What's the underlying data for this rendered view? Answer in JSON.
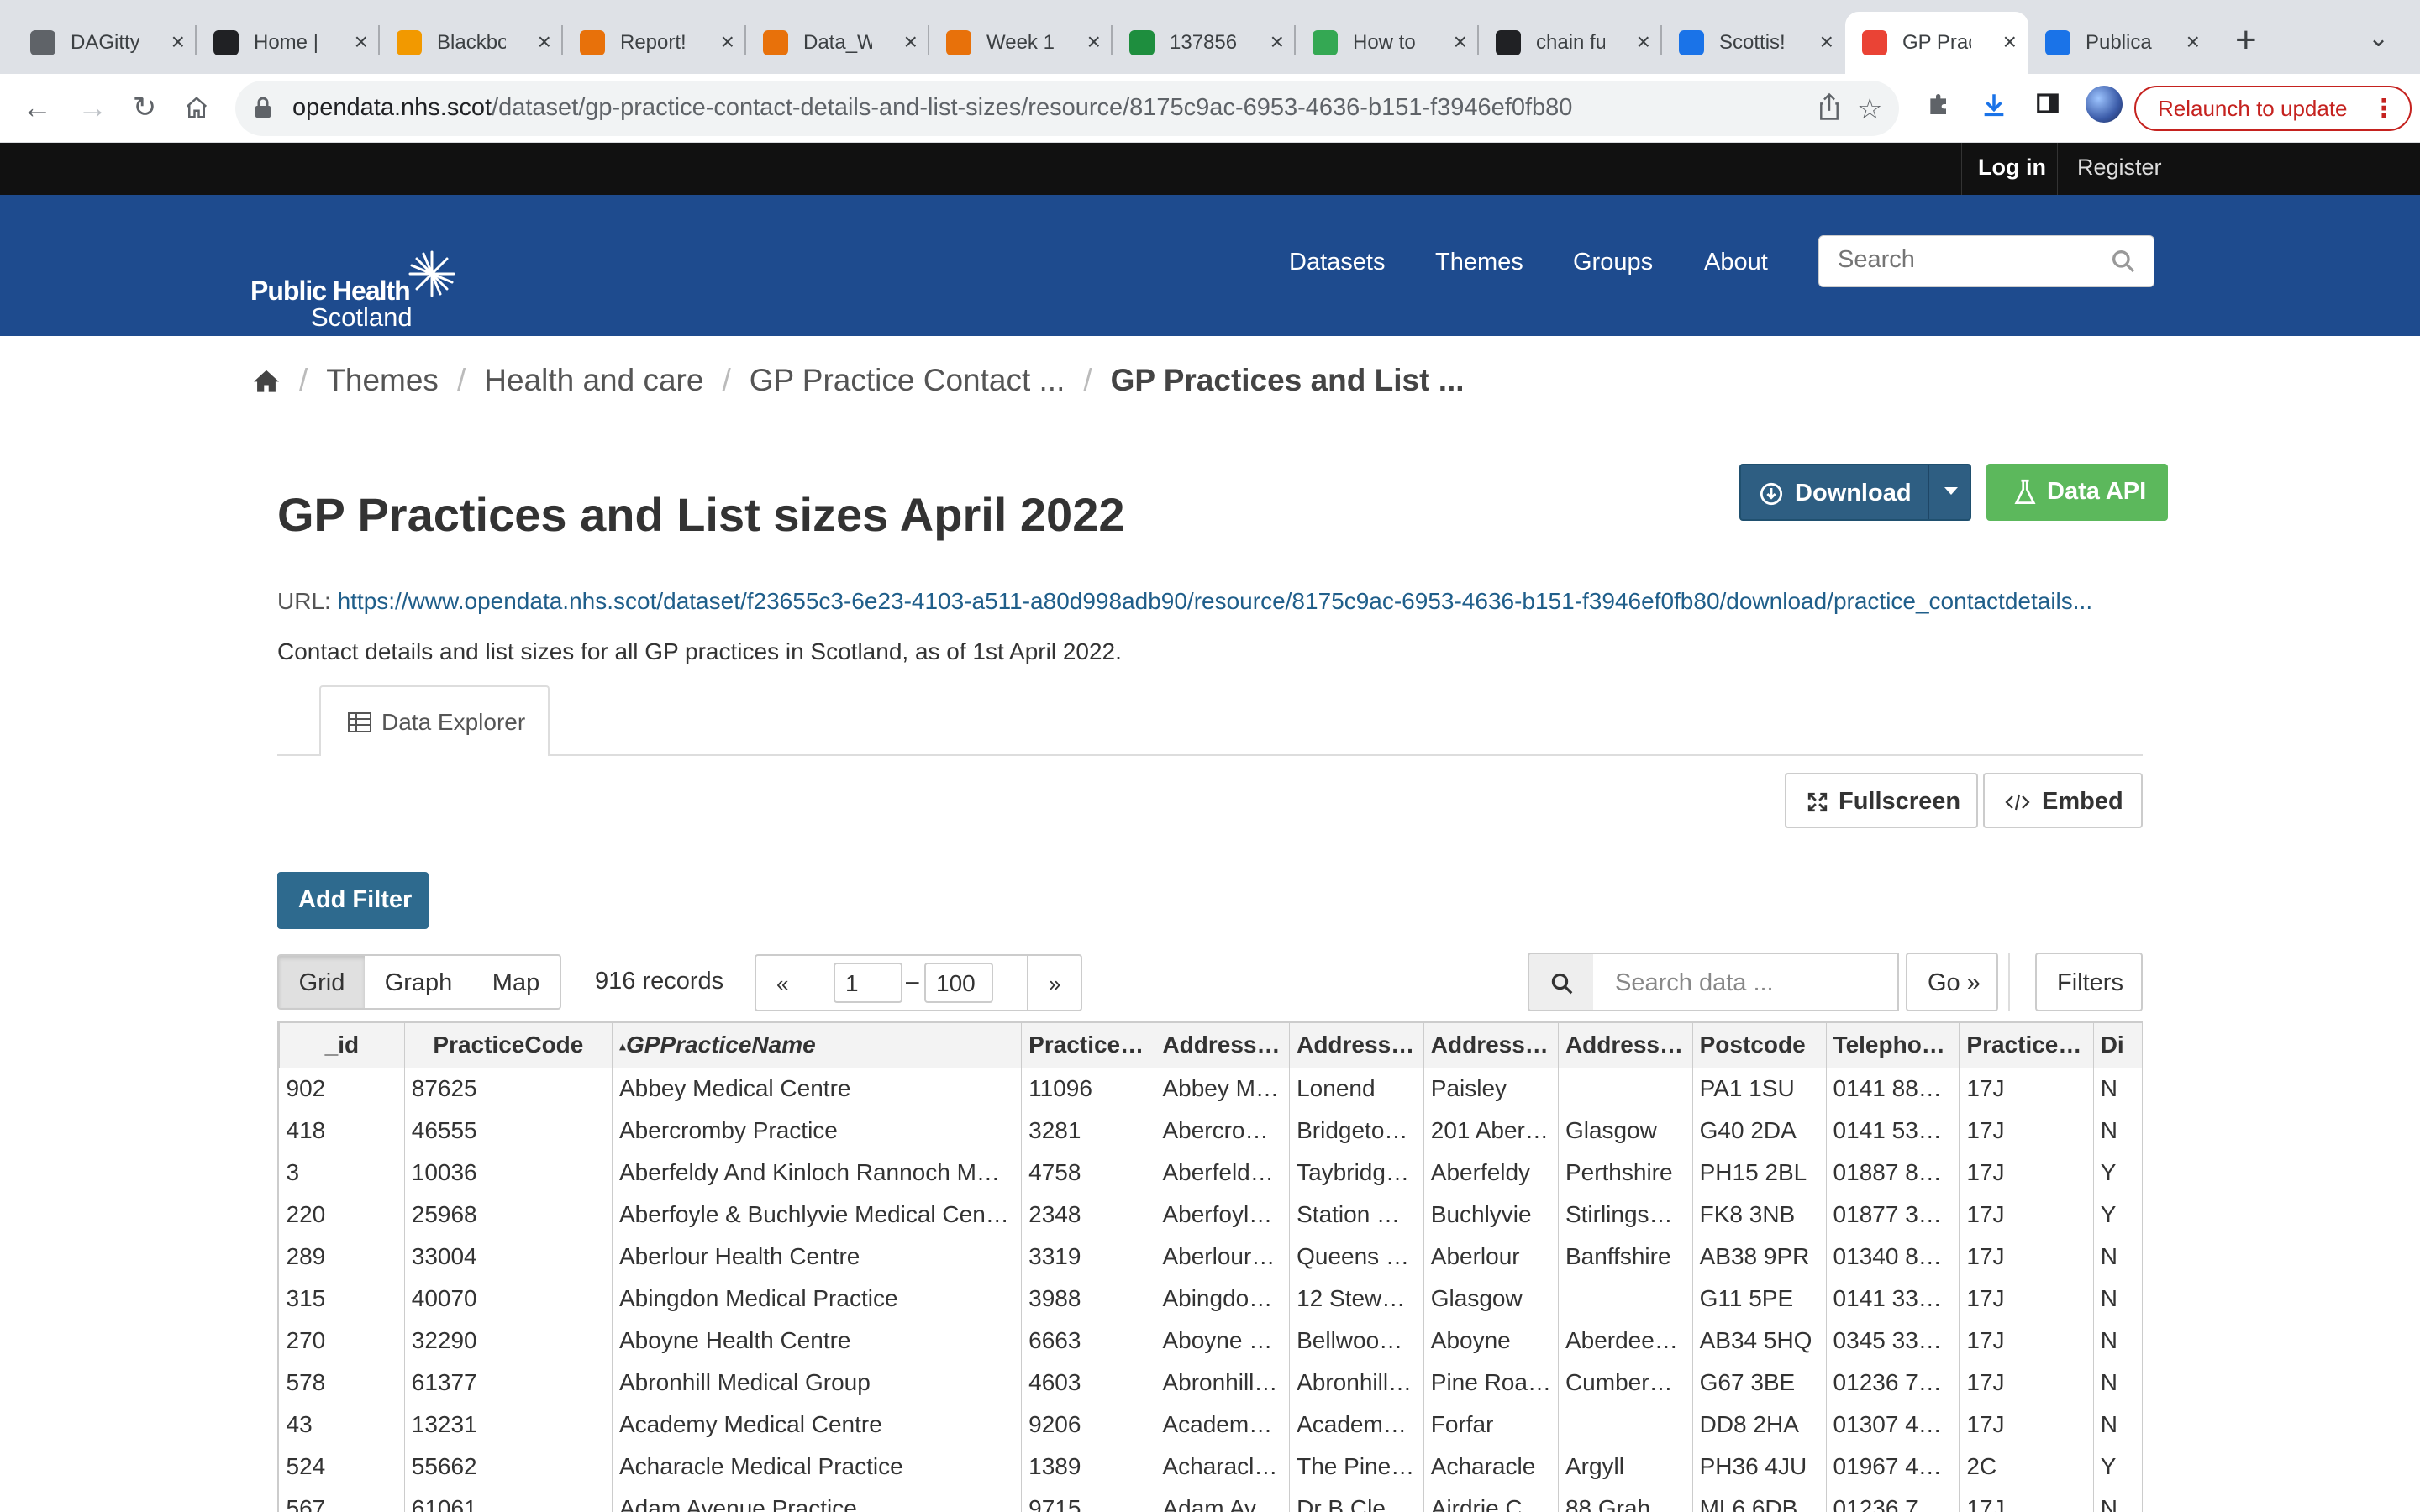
{
  "browser": {
    "tabs": [
      {
        "title": "DAGitty",
        "favicon": "globe-icon",
        "color": "#5f6368"
      },
      {
        "title": "Home |",
        "favicon": "crest-icon",
        "color": "#202124"
      },
      {
        "title": "Blackbo",
        "favicon": "bars-icon",
        "color": "#f29900"
      },
      {
        "title": "Report!",
        "favicon": "arc-icon",
        "color": "#e8710a"
      },
      {
        "title": "Data_W",
        "favicon": "book-icon",
        "color": "#e8710a"
      },
      {
        "title": "Week 1",
        "favicon": "book-icon",
        "color": "#e8710a"
      },
      {
        "title": "137856",
        "favicon": "leaf-icon",
        "color": "#1e8e3e"
      },
      {
        "title": "How to",
        "favicon": "link-icon",
        "color": "#34a853"
      },
      {
        "title": "chain fu",
        "favicon": "r-icon",
        "color": "#202124"
      },
      {
        "title": "Scottis!",
        "favicon": "triangle-icon",
        "color": "#1a73e8"
      },
      {
        "title": "GP Prac",
        "favicon": "gp-icon",
        "color": "#ea4335"
      },
      {
        "title": "Publica",
        "favicon": "saltire-icon",
        "color": "#1a73e8"
      }
    ],
    "active_tab": 10,
    "url_domain": "opendata.nhs.scot",
    "url_path": "/dataset/gp-practice-contact-details-and-list-sizes/resource/8175c9ac-6953-4636-b151-f3946ef0fb80",
    "relaunch_label": "Relaunch to update"
  },
  "site": {
    "login": "Log in",
    "register": "Register",
    "logo_line1": "Public Health",
    "logo_line2": "Scotland",
    "nav": [
      "Datasets",
      "Themes",
      "Groups",
      "About"
    ],
    "search_placeholder": "Search",
    "brand_color": "#1e4b8e"
  },
  "breadcrumb": [
    "Themes",
    "Health and care",
    "GP Practice Contact ...",
    "GP Practices and List ..."
  ],
  "resource": {
    "title": "GP Practices and List sizes April 2022",
    "download_label": "Download",
    "api_label": "Data API",
    "url_label": "URL:",
    "url": "https://www.opendata.nhs.scot/dataset/f23655c3-6e23-4103-a511-a80d998adb90/resource/8175c9ac-6953-4636-b151-f3946ef0fb80/download/practice_contactdetails...",
    "description": "Contact details and list sizes for all GP practices in Scotland, as of 1st April 2022.",
    "explorer_tab": "Data Explorer",
    "fullscreen_label": "Fullscreen",
    "embed_label": "Embed"
  },
  "explorer": {
    "add_filter": "Add Filter",
    "views": [
      "Grid",
      "Graph",
      "Map"
    ],
    "active_view": "Grid",
    "records": "916 records",
    "prev": "«",
    "next": "»",
    "from": "1",
    "dash": "–",
    "to": "100",
    "search_placeholder": "Search data ...",
    "go_label": "Go »",
    "filters_label": "Filters",
    "columns": [
      "_id",
      "PracticeCode",
      "GPPracticeName",
      "Practice…",
      "Address…",
      "Address…",
      "Address…",
      "Address…",
      "Postcode",
      "Telepho…",
      "Practice…",
      "Di"
    ],
    "rows": [
      [
        "902",
        "87625",
        "Abbey Medical Centre",
        "11096",
        "Abbey M…",
        "Lonend",
        "Paisley",
        "",
        "PA1 1SU",
        "0141 88…",
        "17J",
        "N"
      ],
      [
        "418",
        "46555",
        "Abercromby Practice",
        "3281",
        "Abercro…",
        "Bridgeto…",
        "201 Aber…",
        "Glasgow",
        "G40 2DA",
        "0141 53…",
        "17J",
        "N"
      ],
      [
        "3",
        "10036",
        "Aberfeldy And Kinloch Rannoch M…",
        "4758",
        "Aberfeld…",
        "Taybridg…",
        "Aberfeldy",
        "Perthshire",
        "PH15 2BL",
        "01887 8…",
        "17J",
        "Y"
      ],
      [
        "220",
        "25968",
        "Aberfoyle & Buchlyvie Medical Cen…",
        "2348",
        "Aberfoyl…",
        "Station …",
        "Buchlyvie",
        "Stirlings…",
        "FK8 3NB",
        "01877 3…",
        "17J",
        "Y"
      ],
      [
        "289",
        "33004",
        "Aberlour Health Centre",
        "3319",
        "Aberlour…",
        "Queens …",
        "Aberlour",
        "Banffshire",
        "AB38 9PR",
        "01340 8…",
        "17J",
        "N"
      ],
      [
        "315",
        "40070",
        "Abingdon Medical Practice",
        "3988",
        "Abingdo…",
        "12 Stew…",
        "Glasgow",
        "",
        "G11 5PE",
        "0141 33…",
        "17J",
        "N"
      ],
      [
        "270",
        "32290",
        "Aboyne Health Centre",
        "6663",
        "Aboyne …",
        "Bellwoo…",
        "Aboyne",
        "Aberdee…",
        "AB34 5HQ",
        "0345 33…",
        "17J",
        "N"
      ],
      [
        "578",
        "61377",
        "Abronhill Medical Group",
        "4603",
        "Abronhill…",
        "Abronhill…",
        "Pine Roa…",
        "Cumber…",
        "G67 3BE",
        "01236 7…",
        "17J",
        "N"
      ],
      [
        "43",
        "13231",
        "Academy Medical Centre",
        "9206",
        "Academ…",
        "Academ…",
        "Forfar",
        "",
        "DD8 2HA",
        "01307 4…",
        "17J",
        "N"
      ],
      [
        "524",
        "55662",
        "Acharacle Medical Practice",
        "1389",
        "Acharacl…",
        "The Pine…",
        "Acharacle",
        "Argyll",
        "PH36 4JU",
        "01967 4…",
        "2C",
        "Y"
      ],
      [
        "567",
        "61061",
        "Adam Avenue Practice",
        "9715",
        "Adam Av…",
        "Dr B Cle…",
        "Airdrie C…",
        "88 Grah…",
        "ML6 6DB",
        "01236 7…",
        "17J",
        "N"
      ]
    ]
  }
}
